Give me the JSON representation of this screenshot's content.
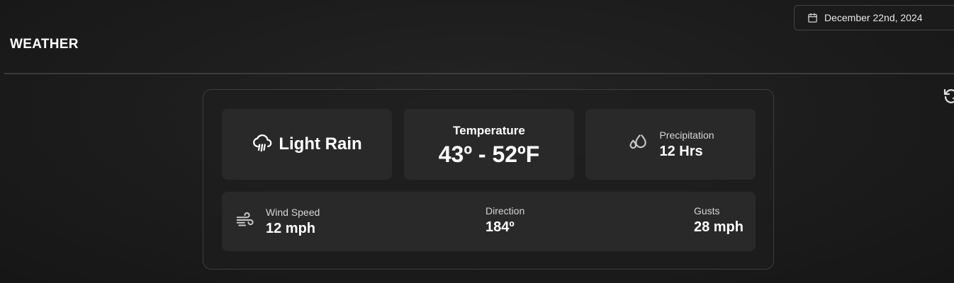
{
  "header": {
    "title": "WEATHER",
    "date": "December 22nd, 2024",
    "date_icon": "calendar-icon",
    "refresh_icon": "refresh-icon"
  },
  "weather": {
    "condition": {
      "icon": "cloud-rain-icon",
      "label": "Light Rain"
    },
    "temperature": {
      "label": "Temperature",
      "value": "43º - 52ºF"
    },
    "precipitation": {
      "icon": "droplets-icon",
      "label": "Precipitation",
      "value": "12 Hrs"
    },
    "wind": {
      "icon": "wind-icon",
      "speed_label": "Wind Speed",
      "speed_value": "12 mph",
      "direction_label": "Direction",
      "direction_value": "184º",
      "gusts_label": "Gusts",
      "gusts_value": "28 mph"
    }
  },
  "colors": {
    "background": "#1c1c1c",
    "tile": "#292929",
    "border": "#3d3d3d",
    "text": "#ffffff"
  }
}
